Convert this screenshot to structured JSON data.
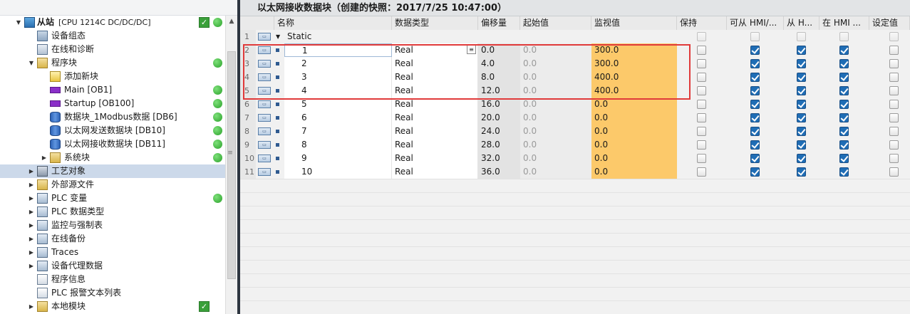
{
  "tree": {
    "items": [
      {
        "label": "从站",
        "suffix": "[CPU 1214C DC/DC/DC]",
        "toggle": "▼",
        "icon": "cpu-icon",
        "status": "check+green",
        "level": 1
      },
      {
        "label": "设备组态",
        "icon": "device-config-icon",
        "level": 2
      },
      {
        "label": "在线和诊断",
        "icon": "diagnostics-icon",
        "level": 2
      },
      {
        "label": "程序块",
        "toggle": "▼",
        "icon": "folder-icon",
        "status": "green",
        "level": 2
      },
      {
        "label": "添加新块",
        "icon": "add-block-icon",
        "level": 3
      },
      {
        "label": "Main [OB1]",
        "icon": "ob-icon",
        "status": "green",
        "level": 3
      },
      {
        "label": "Startup [OB100]",
        "icon": "ob-icon",
        "status": "green",
        "level": 3
      },
      {
        "label": "数据块_1Modbus数据 [DB6]",
        "icon": "db-icon",
        "status": "green",
        "level": 3
      },
      {
        "label": "以太网发送数据块 [DB10]",
        "icon": "db-icon",
        "status": "green",
        "level": 3
      },
      {
        "label": "以太网接收数据块 [DB11]",
        "icon": "db-icon",
        "status": "green",
        "level": 3
      },
      {
        "label": "系统块",
        "toggle": "▶",
        "icon": "folder-icon",
        "status": "green",
        "level": 3
      },
      {
        "label": "工艺对象",
        "toggle": "▶",
        "icon": "technology-icon",
        "level": 2,
        "selected": true
      },
      {
        "label": "外部源文件",
        "toggle": "▶",
        "icon": "folder-icon",
        "level": 2
      },
      {
        "label": "PLC 变量",
        "toggle": "▶",
        "icon": "tags-icon",
        "status": "green",
        "level": 2
      },
      {
        "label": "PLC 数据类型",
        "toggle": "▶",
        "icon": "datatype-icon",
        "level": 2
      },
      {
        "label": "监控与强制表",
        "toggle": "▶",
        "icon": "watch-table-icon",
        "level": 2
      },
      {
        "label": "在线备份",
        "toggle": "▶",
        "icon": "backup-icon",
        "level": 2
      },
      {
        "label": "Traces",
        "toggle": "▶",
        "icon": "traces-icon",
        "level": 2
      },
      {
        "label": "设备代理数据",
        "toggle": "▶",
        "icon": "proxy-icon",
        "level": 2
      },
      {
        "label": "程序信息",
        "icon": "program-info-icon",
        "level": 2
      },
      {
        "label": "PLC 报警文本列表",
        "icon": "alarm-text-icon",
        "level": 2
      },
      {
        "label": "本地模块",
        "toggle": "▶",
        "icon": "folder-icon",
        "status": "check",
        "level": 2
      }
    ],
    "scroll_up_glyph": "▲",
    "scroll_grip_glyph": "≡"
  },
  "editor": {
    "title": "以太网接收数据块（创建的快照：2017/7/25 10:47:00）",
    "columns": [
      "名称",
      "数据类型",
      "偏移量",
      "起始值",
      "监视值",
      "保持",
      "可从 HMI/...",
      "从 H...",
      "在 HMI ...",
      "设定值"
    ],
    "static_row": {
      "num": "1",
      "name": "Static"
    },
    "rows": [
      {
        "num": "2",
        "name": "1",
        "type": "Real",
        "offset": "0.0",
        "start": "0.0",
        "monitor": "300.0",
        "retain": false,
        "hmi_access": true,
        "hmi_visible": true,
        "hmi_setpoint": true,
        "setpoint": false
      },
      {
        "num": "3",
        "name": "2",
        "type": "Real",
        "offset": "4.0",
        "start": "0.0",
        "monitor": "300.0",
        "retain": false,
        "hmi_access": true,
        "hmi_visible": true,
        "hmi_setpoint": true,
        "setpoint": false
      },
      {
        "num": "4",
        "name": "3",
        "type": "Real",
        "offset": "8.0",
        "start": "0.0",
        "monitor": "400.0",
        "retain": false,
        "hmi_access": true,
        "hmi_visible": true,
        "hmi_setpoint": true,
        "setpoint": false
      },
      {
        "num": "5",
        "name": "4",
        "type": "Real",
        "offset": "12.0",
        "start": "0.0",
        "monitor": "400.0",
        "retain": false,
        "hmi_access": true,
        "hmi_visible": true,
        "hmi_setpoint": true,
        "setpoint": false
      },
      {
        "num": "6",
        "name": "5",
        "type": "Real",
        "offset": "16.0",
        "start": "0.0",
        "monitor": "0.0",
        "retain": false,
        "hmi_access": true,
        "hmi_visible": true,
        "hmi_setpoint": true,
        "setpoint": false
      },
      {
        "num": "7",
        "name": "6",
        "type": "Real",
        "offset": "20.0",
        "start": "0.0",
        "monitor": "0.0",
        "retain": false,
        "hmi_access": true,
        "hmi_visible": true,
        "hmi_setpoint": true,
        "setpoint": false
      },
      {
        "num": "8",
        "name": "7",
        "type": "Real",
        "offset": "24.0",
        "start": "0.0",
        "monitor": "0.0",
        "retain": false,
        "hmi_access": true,
        "hmi_visible": true,
        "hmi_setpoint": true,
        "setpoint": false
      },
      {
        "num": "9",
        "name": "8",
        "type": "Real",
        "offset": "28.0",
        "start": "0.0",
        "monitor": "0.0",
        "retain": false,
        "hmi_access": true,
        "hmi_visible": true,
        "hmi_setpoint": true,
        "setpoint": false
      },
      {
        "num": "10",
        "name": "9",
        "type": "Real",
        "offset": "32.0",
        "start": "0.0",
        "monitor": "0.0",
        "retain": false,
        "hmi_access": true,
        "hmi_visible": true,
        "hmi_setpoint": true,
        "setpoint": false
      },
      {
        "num": "11",
        "name": "10",
        "type": "Real",
        "offset": "36.0",
        "start": "0.0",
        "monitor": "0.0",
        "retain": false,
        "hmi_access": true,
        "hmi_visible": true,
        "hmi_setpoint": true,
        "setpoint": false
      }
    ],
    "iface_icon_text": "▭",
    "list_button_glyph": "≡",
    "static_toggle": "▼"
  },
  "colors": {
    "monitor_highlight": "#fcc96a",
    "selection_box": "#e03a3a",
    "checkbox_on": "#1f6db5",
    "status_green": "#2aa12a",
    "selected_tree_row": "#ccd9ea"
  }
}
